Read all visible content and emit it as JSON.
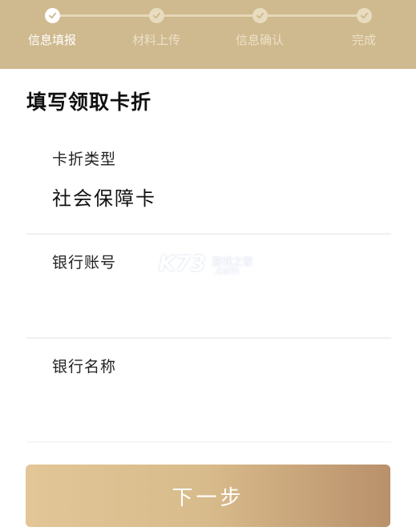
{
  "stepper": {
    "steps": [
      {
        "label": "信息填报",
        "active": true
      },
      {
        "label": "材料上传",
        "active": false
      },
      {
        "label": "信息确认",
        "active": false
      },
      {
        "label": "完成",
        "active": false
      }
    ],
    "colors": {
      "bar": "#cfb98e",
      "active": "#ffffff",
      "inactive": "#ece1c8"
    }
  },
  "form": {
    "title": "填写领取卡折",
    "card_type": {
      "label": "卡折类型",
      "value": "社会保障卡"
    },
    "bank_account": {
      "label": "银行账号",
      "value": ""
    },
    "bank_name": {
      "label": "银行名称",
      "value": ""
    }
  },
  "watermark": {
    "brand": "K73",
    "text": "游戏之家",
    "domain": ".com"
  },
  "footer": {
    "next_label": "下一步"
  }
}
